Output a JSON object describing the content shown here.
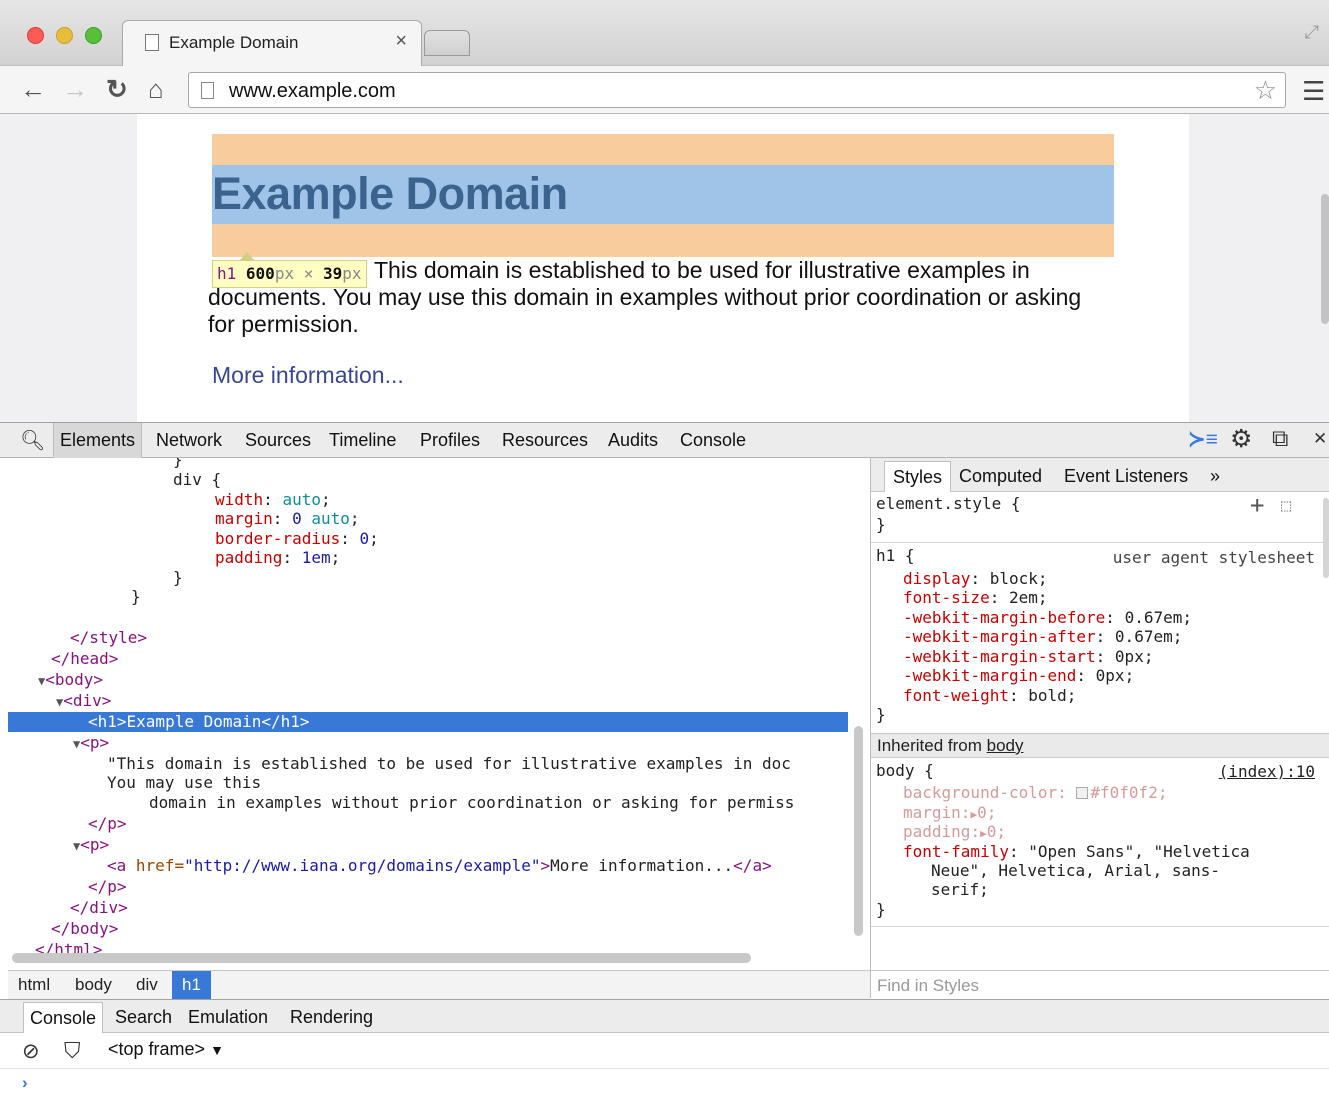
{
  "browser": {
    "tab_title": "Example Domain",
    "tab_close": "×",
    "url": "www.example.com"
  },
  "page": {
    "heading": "Example Domain",
    "paragraph": "This domain is established to be used for illustrative examples in documents. You may use this domain in examples without prior coordination or asking for permission.",
    "link": "More information...",
    "tooltip_tag": "h1",
    "tooltip_width": "600",
    "tooltip_height": "39",
    "tooltip_unit": "px",
    "tooltip_times": "×"
  },
  "devtools": {
    "tabs": [
      "Elements",
      "Network",
      "Sources",
      "Timeline",
      "Profiles",
      "Resources",
      "Audits",
      "Console"
    ],
    "selected_tab": "Elements",
    "breadcrumbs": [
      "html",
      "body",
      "div",
      "h1"
    ],
    "selected_breadcrumb": "h1",
    "styles_tabs": [
      "Styles",
      "Computed",
      "Event Listeners"
    ],
    "styles_more": "»",
    "find_placeholder": "Find in Styles",
    "drawer_tabs": [
      "Console",
      "Search",
      "Emulation",
      "Rendering"
    ],
    "frame": "<top frame>",
    "frame_arrow": "▼",
    "prompt": "›"
  },
  "elements_code": {
    "brace_cut": "}",
    "div_selector": "div {",
    "width_prop": "width",
    "width_val": "auto",
    "margin_prop": "margin",
    "margin_val0": "0",
    "margin_val1": "auto",
    "radius_prop": "border-radius",
    "radius_val": "0",
    "padding_prop": "padding",
    "padding_val": "1em",
    "close_brace": "}",
    "style_close": "</style>",
    "head_close": "</head>",
    "body_open": "<body>",
    "div_open": "<div>",
    "h1_line": "<h1>Example Domain</h1>",
    "p_open": "<p>",
    "text_line1": "\"This domain is established to be used for illustrative examples in doc",
    "text_line2": "You may use this",
    "text_line3": "domain in examples without prior coordination or asking for permiss",
    "p_close": "</p>",
    "a_open": "<a ",
    "href_attr": "href=",
    "href_val": "\"http://www.iana.org/domains/example\"",
    "a_text": "More information...",
    "a_close": "</a>",
    "div_close": "</div>",
    "body_close": "</body>",
    "html_close": "</html>"
  },
  "styles": {
    "element_style": "element.style {",
    "element_close": "}",
    "h1_selector": "h1 {",
    "ua": "user agent stylesheet",
    "h1_rules": [
      {
        "prop": "display",
        "val": "block"
      },
      {
        "prop": "font-size",
        "val": "2em"
      },
      {
        "prop": "-webkit-margin-before",
        "val": "0.67em"
      },
      {
        "prop": "-webkit-margin-after",
        "val": "0.67em"
      },
      {
        "prop": "-webkit-margin-start",
        "val": "0px"
      },
      {
        "prop": "-webkit-margin-end",
        "val": "0px"
      },
      {
        "prop": "font-weight",
        "val": "bold"
      }
    ],
    "h1_close": "}",
    "inherited_label": "Inherited from ",
    "inherited_from": "body",
    "body_selector": "body {",
    "body_source": "(index):10",
    "bg_prop": "background-color",
    "bg_val": "#f0f0f2",
    "margin_prop": "margin",
    "margin_val": "0",
    "padding_prop": "padding",
    "padding_val": "0",
    "font_prop": "font-family",
    "font_val1": "\"Open Sans\", \"Helvetica",
    "font_val2": "Neue\", Helvetica, Arial, sans-",
    "font_val3": "serif;",
    "body_close": "}"
  },
  "colors": {
    "selection": "#3878d6",
    "margin_overlay": "#f9cc9d",
    "content_overlay": "#9fc4e7"
  }
}
